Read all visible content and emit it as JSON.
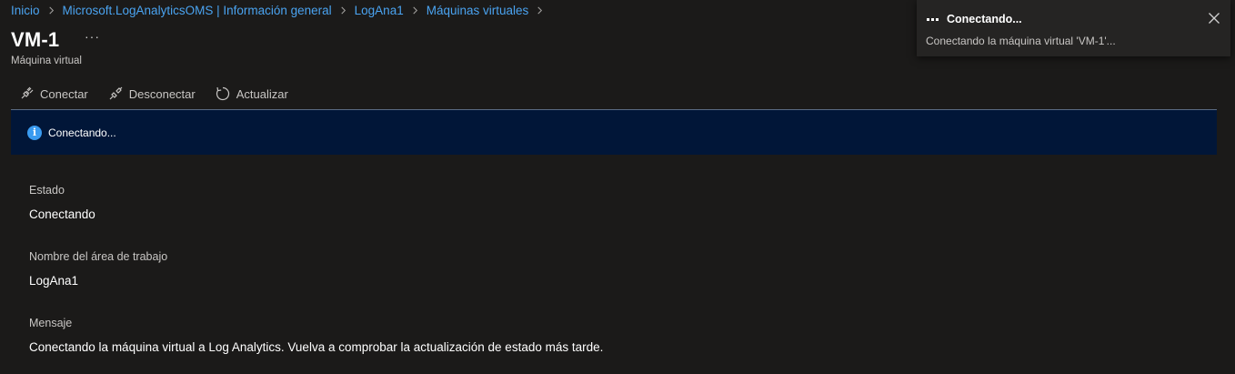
{
  "breadcrumb": [
    {
      "label": "Inicio"
    },
    {
      "label": "Microsoft.LogAnalyticsOMS | Información general"
    },
    {
      "label": "LogAna1"
    },
    {
      "label": "Máquinas virtuales"
    }
  ],
  "page": {
    "title": "VM-1",
    "more": "···",
    "subtitle": "Máquina virtual"
  },
  "toolbar": {
    "connect_label": "Conectar",
    "disconnect_label": "Desconectar",
    "refresh_label": "Actualizar"
  },
  "banner": {
    "icon": "info-icon",
    "icon_glyph": "i",
    "text": "Conectando..."
  },
  "properties": [
    {
      "label": "Estado",
      "value": "Conectando"
    },
    {
      "label": "Nombre del área de trabajo",
      "value": "LogAna1"
    },
    {
      "label": "Mensaje",
      "value": "Conectando la máquina virtual a Log Analytics. Vuelva a comprobar la actualización de estado más tarde."
    }
  ],
  "notification": {
    "title": "Conectando...",
    "body": "Conectando la máquina virtual 'VM-1'..."
  },
  "colors": {
    "background": "#1b1a19",
    "link": "#4aa3f0",
    "banner_bg": "#011638",
    "info_icon": "#3a9bf0",
    "toast_bg": "#252423"
  }
}
